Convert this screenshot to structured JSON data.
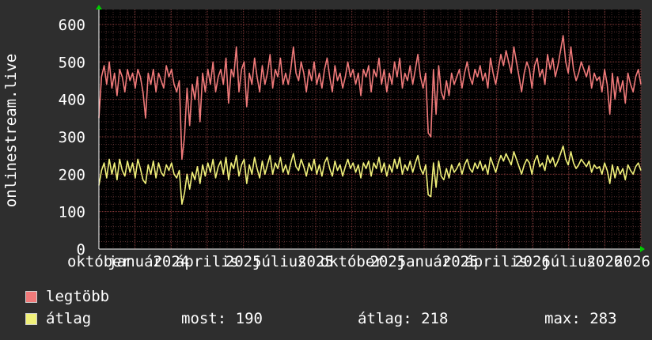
{
  "chart_data": {
    "type": "line",
    "ylabel": "onlinestream.live",
    "ylim": [
      0,
      640
    ],
    "yticks": [
      0,
      100,
      200,
      300,
      400,
      500,
      600
    ],
    "xtick_labels": [
      "október",
      "január",
      "2024",
      "április",
      "2025",
      "július",
      "2025",
      "október",
      "2025",
      "január",
      "2025",
      "április",
      "2026",
      "július",
      "2026",
      "2026"
    ],
    "grid": true,
    "legend_placement": "bottom-left",
    "series": [
      {
        "name": "legtöbb",
        "color": "#f07a7a",
        "values": [
          350,
          460,
          490,
          440,
          500,
          430,
          470,
          410,
          480,
          460,
          420,
          480,
          450,
          470,
          430,
          480,
          460,
          420,
          350,
          470,
          440,
          480,
          420,
          470,
          450,
          430,
          490,
          460,
          480,
          440,
          420,
          450,
          240,
          300,
          430,
          330,
          440,
          400,
          460,
          340,
          470,
          420,
          480,
          440,
          500,
          420,
          460,
          480,
          440,
          510,
          390,
          480,
          460,
          540,
          420,
          480,
          500,
          380,
          470,
          440,
          510,
          460,
          420,
          490,
          440,
          470,
          520,
          430,
          480,
          460,
          510,
          440,
          470,
          440,
          480,
          540,
          470,
          450,
          500,
          470,
          420,
          480,
          450,
          500,
          440,
          470,
          430,
          480,
          510,
          460,
          420,
          490,
          450,
          470,
          430,
          460,
          500,
          460,
          480,
          440,
          470,
          410,
          480,
          460,
          490,
          420,
          480,
          460,
          510,
          440,
          480,
          420,
          470,
          440,
          500,
          460,
          510,
          430,
          470,
          450,
          490,
          440,
          480,
          520,
          460,
          430,
          470,
          310,
          300,
          480,
          360,
          490,
          420,
          400,
          450,
          410,
          470,
          440,
          460,
          480,
          430,
          470,
          500,
          460,
          440,
          480,
          460,
          490,
          450,
          470,
          430,
          510,
          470,
          440,
          480,
          520,
          490,
          530,
          500,
          470,
          540,
          500,
          460,
          420,
          470,
          500,
          480,
          430,
          490,
          510,
          460,
          480,
          440,
          520,
          480,
          510,
          460,
          490,
          530,
          570,
          500,
          470,
          540,
          480,
          450,
          470,
          500,
          480,
          460,
          490,
          430,
          470,
          450,
          460,
          420,
          480,
          440,
          360,
          470,
          400,
          460,
          420,
          450,
          390,
          470,
          440,
          420,
          460,
          480,
          440
        ]
      },
      {
        "name": "átlag",
        "color": "#f0f07a",
        "values": [
          170,
          210,
          230,
          190,
          240,
          200,
          230,
          185,
          240,
          210,
          195,
          235,
          205,
          230,
          190,
          240,
          215,
          185,
          175,
          225,
          200,
          235,
          190,
          230,
          205,
          195,
          225,
          210,
          230,
          200,
          190,
          210,
          120,
          150,
          200,
          160,
          205,
          185,
          220,
          175,
          225,
          195,
          230,
          205,
          240,
          190,
          220,
          235,
          200,
          245,
          185,
          230,
          215,
          250,
          195,
          225,
          240,
          175,
          225,
          200,
          245,
          215,
          190,
          235,
          200,
          225,
          250,
          200,
          230,
          215,
          245,
          205,
          225,
          200,
          230,
          255,
          220,
          210,
          240,
          220,
          195,
          230,
          210,
          240,
          200,
          225,
          195,
          230,
          245,
          215,
          195,
          235,
          210,
          225,
          195,
          220,
          240,
          215,
          230,
          205,
          225,
          190,
          230,
          215,
          235,
          195,
          230,
          215,
          245,
          205,
          230,
          195,
          225,
          205,
          240,
          215,
          245,
          200,
          225,
          210,
          235,
          205,
          230,
          250,
          215,
          200,
          225,
          145,
          140,
          230,
          165,
          235,
          195,
          185,
          215,
          190,
          225,
          205,
          215,
          230,
          200,
          225,
          240,
          215,
          205,
          230,
          215,
          235,
          210,
          225,
          200,
          245,
          225,
          205,
          230,
          250,
          235,
          255,
          240,
          225,
          260,
          240,
          220,
          200,
          225,
          240,
          230,
          200,
          235,
          250,
          220,
          230,
          210,
          250,
          230,
          245,
          220,
          235,
          255,
          275,
          240,
          225,
          260,
          230,
          215,
          225,
          240,
          230,
          220,
          235,
          205,
          225,
          215,
          220,
          200,
          230,
          210,
          175,
          225,
          190,
          220,
          200,
          215,
          185,
          225,
          210,
          200,
          220,
          230,
          210
        ]
      }
    ]
  },
  "legend": {
    "items": [
      {
        "label": "legtöbb",
        "color": "#f07a7a"
      },
      {
        "label": "átlag",
        "color": "#f0f07a"
      }
    ],
    "stats": {
      "now": "most: 190",
      "avg": "átlag: 218",
      "max": "max: 283"
    }
  }
}
